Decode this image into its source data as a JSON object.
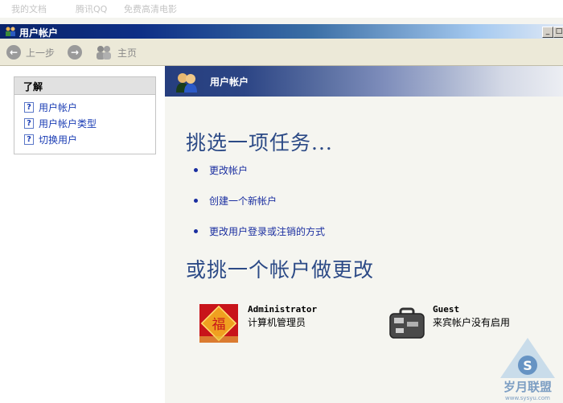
{
  "desktop": {
    "items": [
      "我的文档",
      "腾讯QQ",
      "免费高清电影"
    ]
  },
  "window": {
    "title": "用户帐户"
  },
  "toolbar": {
    "back_label": "上一步",
    "home_label": "主页"
  },
  "sidebar": {
    "title": "了解",
    "items": [
      {
        "label": "用户帐户"
      },
      {
        "label": "用户帐户类型"
      },
      {
        "label": "切换用户"
      }
    ]
  },
  "banner": {
    "title": "用户帐户"
  },
  "main": {
    "task_heading": "挑选一项任务...",
    "tasks": [
      {
        "label": "更改帐户"
      },
      {
        "label": "创建一个新帐户"
      },
      {
        "label": "更改用户登录或注销的方式"
      }
    ],
    "account_heading": "或挑一个帐户做更改",
    "accounts": [
      {
        "name": "Administrator",
        "description": "计算机管理员"
      },
      {
        "name": "Guest",
        "description": "来宾帐户没有启用"
      }
    ]
  },
  "watermark": {
    "text": "岁月联盟",
    "url": "www.sysyu.com"
  },
  "colors": {
    "heading": "#2c4a86",
    "link": "#1a2ea0",
    "titlebar": "#0a246a"
  }
}
